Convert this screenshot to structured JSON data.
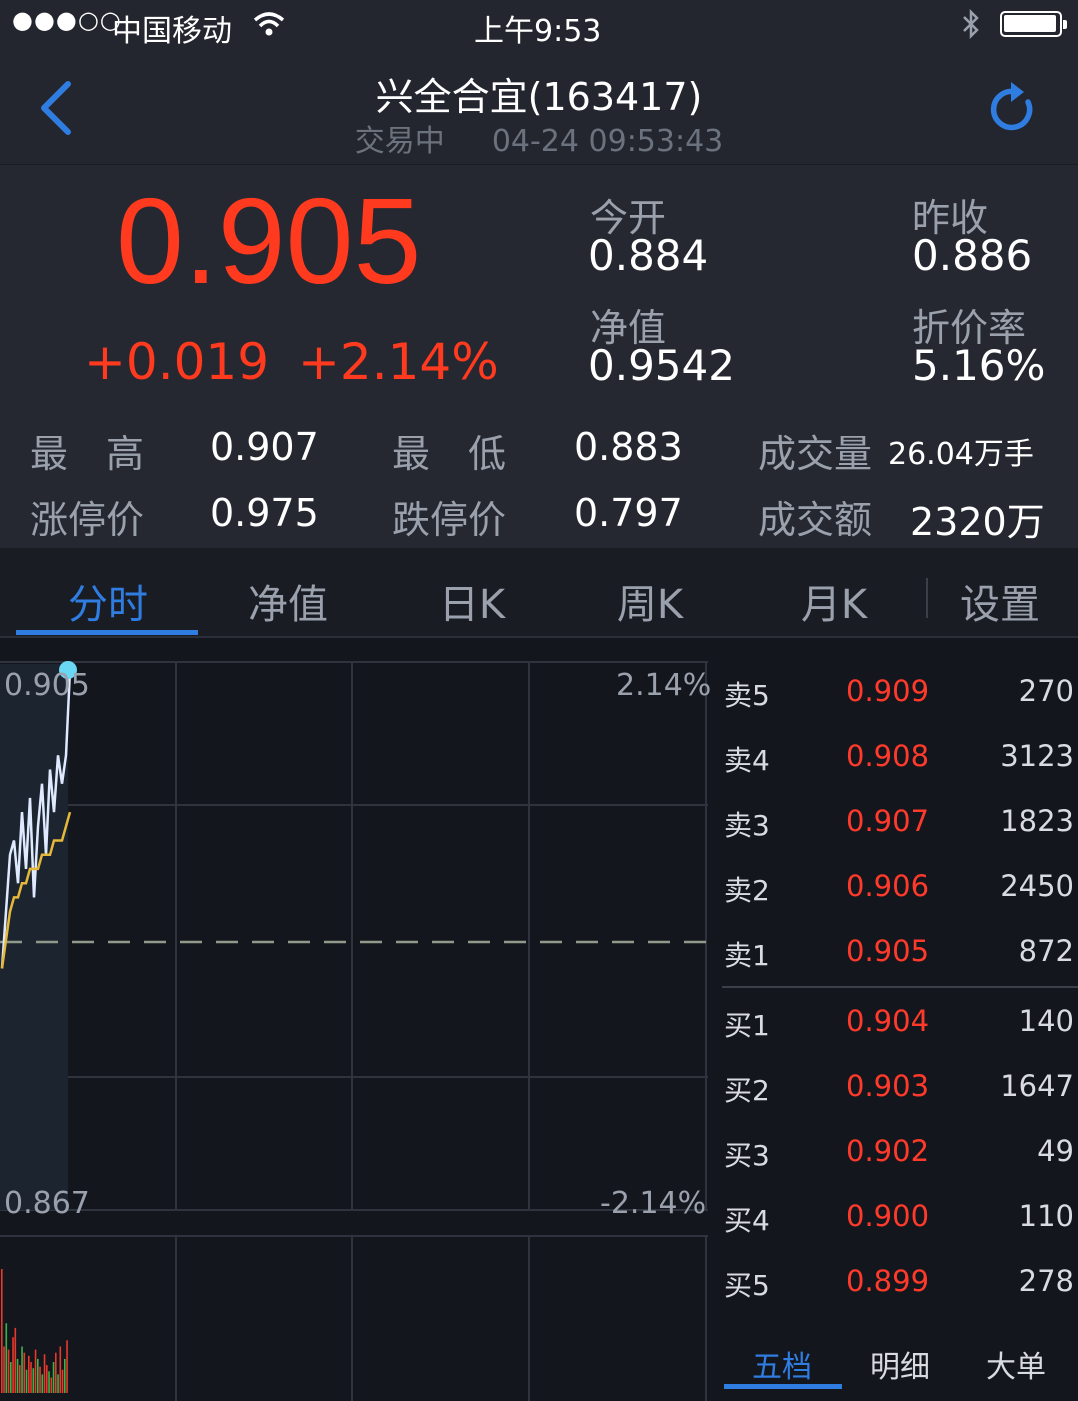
{
  "status_bar": {
    "signal": "●●●○○",
    "carrier": "中国移动",
    "time": "上午9:53"
  },
  "header": {
    "title": "兴全合宜(163417)",
    "trade_status": "交易中",
    "datetime": "04-24 09:53:43"
  },
  "quote": {
    "price": "0.905",
    "change": "+0.019",
    "change_pct": "+2.14%",
    "open_label": "今开",
    "open": "0.884",
    "prev_close_label": "昨收",
    "prev_close": "0.886",
    "nav_label": "净值",
    "nav": "0.9542",
    "discount_label": "折价率",
    "discount": "5.16%",
    "high_label": "最　高",
    "high": "0.907",
    "low_label": "最　低",
    "low": "0.883",
    "volume_label": "成交量",
    "volume": "26.04万手",
    "limit_up_label": "涨停价",
    "limit_up": "0.975",
    "limit_down_label": "跌停价",
    "limit_down": "0.797",
    "turnover_label": "成交额",
    "turnover": "2320万"
  },
  "tabs": [
    "分时",
    "净值",
    "日K",
    "周K",
    "月K",
    "设置"
  ],
  "active_tab": 0,
  "chart_axis": {
    "max_price": "0.905",
    "min_price": "0.867",
    "max_pct": "2.14%",
    "min_pct": "-2.14%"
  },
  "order_book": {
    "asks": [
      {
        "label": "卖5",
        "price": "0.909",
        "volume": "270"
      },
      {
        "label": "卖4",
        "price": "0.908",
        "volume": "3123"
      },
      {
        "label": "卖3",
        "price": "0.907",
        "volume": "1823"
      },
      {
        "label": "卖2",
        "price": "0.906",
        "volume": "2450"
      },
      {
        "label": "卖1",
        "price": "0.905",
        "volume": "872"
      }
    ],
    "bids": [
      {
        "label": "买1",
        "price": "0.904",
        "volume": "140"
      },
      {
        "label": "买2",
        "price": "0.903",
        "volume": "1647"
      },
      {
        "label": "买3",
        "price": "0.902",
        "volume": "49"
      },
      {
        "label": "买4",
        "price": "0.900",
        "volume": "110"
      },
      {
        "label": "买5",
        "price": "0.899",
        "volume": "278"
      }
    ]
  },
  "bottom_tabs": [
    "五档",
    "明细",
    "大单"
  ],
  "chart_data": {
    "type": "line",
    "y_range": [
      0.867,
      0.905
    ],
    "prev_close": 0.886,
    "series": [
      {
        "values": [
          0.884,
          0.888,
          0.892,
          0.893,
          0.89,
          0.895,
          0.891,
          0.896,
          0.889,
          0.894,
          0.897,
          0.892,
          0.898,
          0.895,
          0.899,
          0.897,
          0.899,
          0.905
        ]
      },
      {
        "values": [
          0.884,
          0.886,
          0.888,
          0.889,
          0.889,
          0.89,
          0.89,
          0.891,
          0.891,
          0.891,
          0.892,
          0.892,
          0.892,
          0.893,
          0.893,
          0.893,
          0.894,
          0.895
        ]
      }
    ],
    "volume_bars": [
      0.8,
      0.3,
      0.45,
      0.28,
      0.2,
      0.36,
      0.42,
      0.22,
      0.18,
      0.3,
      0.26,
      0.15,
      0.24,
      0.2,
      0.16,
      0.28,
      0.22,
      0.17,
      0.12,
      0.25,
      0.18,
      0.14,
      0.1,
      0.2,
      0.26,
      0.12,
      0.3,
      0.15,
      0.22,
      0.34
    ],
    "volume_colors": [
      "#e8392b",
      "#e8392b",
      "#3bb34a",
      "#e8392b",
      "#3bb34a",
      "#e8392b",
      "#e8392b",
      "#3bb34a",
      "#e8392b",
      "#3bb34a",
      "#e8392b",
      "#3bb34a",
      "#e8392b",
      "#e8392b",
      "#3bb34a",
      "#e8392b",
      "#3bb34a",
      "#e8392b",
      "#3bb34a",
      "#e8392b",
      "#e8392b",
      "#3bb34a",
      "#e8392b",
      "#3bb34a",
      "#e8392b",
      "#3bb34a",
      "#e8392b",
      "#e8392b",
      "#3bb34a",
      "#e8392b"
    ]
  }
}
